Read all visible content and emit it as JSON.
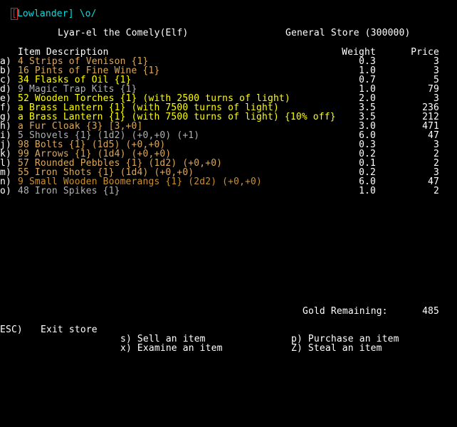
{
  "prompt": {
    "cursor_char": "[",
    "text": "Lowlander] \\o/"
  },
  "header": {
    "character": "Lyar-el the Comely(Elf)",
    "store": "General Store (300000)"
  },
  "columns": {
    "description": "Item Description",
    "weight": "Weight",
    "price": "Price"
  },
  "items": [
    {
      "key": "a)",
      "desc": "4 Strips of Venison {1}",
      "weight": "0.3",
      "price": "3",
      "color": "#d8a860"
    },
    {
      "key": "b)",
      "desc": "16 Pints of Fine Wine {1}",
      "weight": "1.0",
      "price": "3",
      "color": "#d8a860"
    },
    {
      "key": "c)",
      "desc": "34 Flasks of Oil {1}",
      "weight": "0.7",
      "price": "5",
      "color": "#ffff00"
    },
    {
      "key": "d)",
      "desc": "9 Magic Trap Kits {1}",
      "weight": "1.0",
      "price": "79",
      "color": "#b0b0b0"
    },
    {
      "key": "e)",
      "desc": "52 Wooden Torches {1} (with 2500 turns of light)",
      "weight": "2.0",
      "price": "3",
      "color": "#ffff00"
    },
    {
      "key": "f)",
      "desc": "a Brass Lantern {1} (with 7500 turns of light)",
      "weight": "3.5",
      "price": "236",
      "color": "#ffff00"
    },
    {
      "key": "g)",
      "desc": "a Brass Lantern {1} (with 7500 turns of light) {10% off}",
      "weight": "3.5",
      "price": "212",
      "color": "#ffff00"
    },
    {
      "key": "h)",
      "desc": "a Fur Cloak {3} [3,+0]",
      "weight": "3.0",
      "price": "471",
      "color": "#d8a860"
    },
    {
      "key": "i)",
      "desc": "5 Shovels {1} (1d2) (+0,+0) (+1)",
      "weight": "6.0",
      "price": "47",
      "color": "#b0b0b0"
    },
    {
      "key": "j)",
      "desc": "98 Bolts {1} (1d5) (+0,+0)",
      "weight": "0.3",
      "price": "3",
      "color": "#d8a860"
    },
    {
      "key": "k)",
      "desc": "99 Arrows {1} (1d4) (+0,+0)",
      "weight": "0.2",
      "price": "2",
      "color": "#d8a860"
    },
    {
      "key": "l)",
      "desc": "57 Rounded Pebbles {1} (1d2) (+0,+0)",
      "weight": "0.1",
      "price": "2",
      "color": "#d8a860"
    },
    {
      "key": "m)",
      "desc": "55 Iron Shots {1} (1d4) (+0,+0)",
      "weight": "0.2",
      "price": "3",
      "color": "#d8a860"
    },
    {
      "key": "n)",
      "desc": "9 Small Wooden Boomerangs {1} (2d2) (+0,+0)",
      "weight": "6.0",
      "price": "47",
      "color": "#c89030"
    },
    {
      "key": "o)",
      "desc": "48 Iron Spikes {1}",
      "weight": "1.0",
      "price": "2",
      "color": "#b0b0b0"
    }
  ],
  "gold": {
    "label": "Gold Remaining:",
    "value": "485"
  },
  "commands": {
    "exit": {
      "key": "ESC)",
      "label": "Exit store"
    },
    "sell": "s) Sell an item",
    "examine": "x) Examine an item",
    "purchase": "p) Purchase an item",
    "steal": "Z) Steal an item"
  }
}
